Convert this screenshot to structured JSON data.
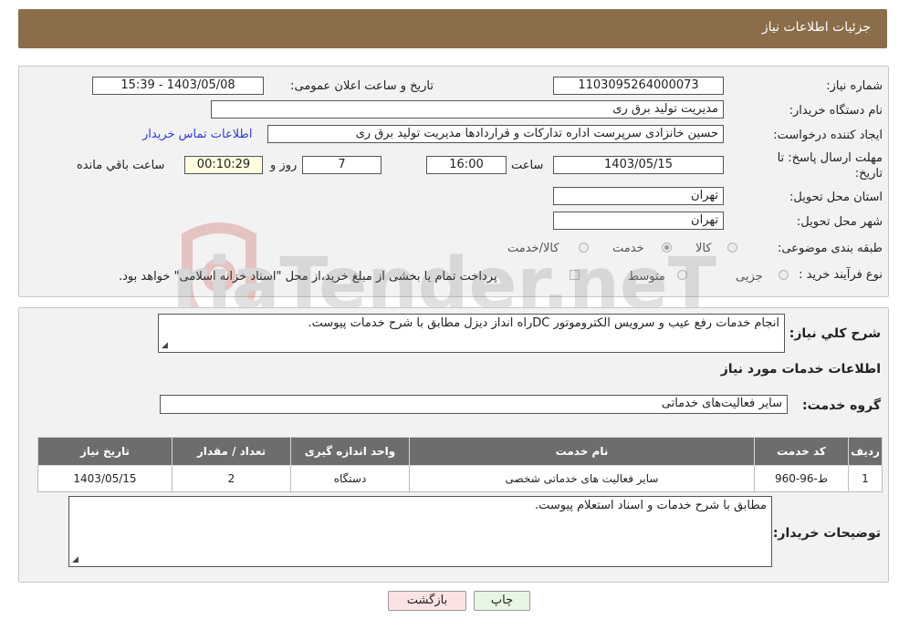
{
  "header": {
    "title": "جزئیات اطلاعات نیاز"
  },
  "form": {
    "need_number_label": "شماره نیاز:",
    "need_number": "1103095264000073",
    "announce_label": "تاریخ و ساعت اعلان عمومی:",
    "announce_value": "1403/05/08 - 15:39",
    "buyer_org_label": "نام دستگاه خریدار:",
    "buyer_org": "مدیریت تولید برق ری",
    "creator_label": "ایجاد کننده درخواست:",
    "creator": "حسین خانزادی سرپرست اداره تدارکات و قراردادها مدیریت تولید برق ری",
    "contact_link": "اطلاعات تماس خریدار",
    "deadline_label_1": "مهلت ارسال پاسخ: تا",
    "deadline_label_2": "تاریخ:",
    "deadline_date": "1403/05/15",
    "time_label": "ساعت",
    "deadline_time": "16:00",
    "days_value": "7",
    "days_label": "روز و",
    "remaining_value": "00:10:29",
    "remaining_label": "ساعت باقي مانده",
    "province_label": "استان محل تحویل:",
    "province": "تهران",
    "city_label": "شهر محل تحویل:",
    "city": "تهران",
    "category_label": "طبقه بندی موضوعی:",
    "category_options": [
      "کالا",
      "خدمت",
      "کالا/خدمت"
    ],
    "process_label": "نوع فرآیند خرید :",
    "process_options": [
      "جزیی",
      "متوسط"
    ],
    "payment_note": "پرداخت تمام یا بخشی از مبلغ خرید،از محل \"اسناد خزانه اسلامی\" خواهد بود."
  },
  "details": {
    "summary_label": "شرح كلي نياز:",
    "summary_text": "انجام خدمات رفع عیب و سرویس الکتروموتور  DCراه انداز دیزل مطابق با شرح خدمات پیوست.",
    "services_title": "اطلاعات خدمات مورد نیاز",
    "service_group_label": "گروه خدمت:",
    "service_group": "سایر فعالیت‌های خدماتی",
    "table": {
      "headers": [
        "ردیف",
        "کد خدمت",
        "نام خدمت",
        "واحد اندازه گیری",
        "تعداد / مقدار",
        "تاریخ نیاز"
      ],
      "rows": [
        [
          "1",
          "ط-96-960",
          "سایر فعالیت های خدماتی شخصی",
          "دستگاه",
          "2",
          "1403/05/15"
        ]
      ]
    },
    "buyer_notes_label": "توضیحات خریدار:",
    "buyer_notes": "مطابق با شرح خدمات و اسناد استعلام پیوست."
  },
  "buttons": {
    "print": "چاپ",
    "back": "بازگشت"
  },
  "watermark": {
    "text": "AriaTender.neT"
  },
  "colors": {
    "header_bg": "#8b6d4a",
    "table_header_bg": "#6d6d6d",
    "back_btn_bg": "#fbe3e4",
    "print_btn_bg": "#e8f7e4",
    "link": "#2f3ccf"
  }
}
